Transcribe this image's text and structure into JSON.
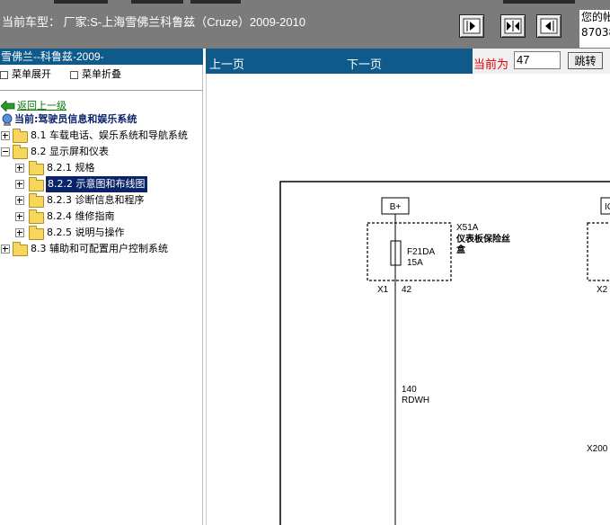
{
  "header": {
    "car_model": "当前车型：  厂家:S-上海雪佛兰科鲁兹（Cruze）2009-2010",
    "user_line1": "您的帐",
    "user_line2": "87038"
  },
  "left": {
    "title": "雪佛兰--科鲁兹-2009-",
    "expand_all": "菜单展开",
    "collapse_all": "菜单折叠",
    "back": "返回上一级",
    "current": "当前:驾驶员信息和娱乐系统",
    "tree": [
      {
        "label": "8.1 车载电话、娱乐系统和导航系统",
        "state": "collapsed",
        "level": 0
      },
      {
        "label": "8.2 显示屏和仪表",
        "state": "expanded",
        "level": 0
      },
      {
        "label": "8.2.1 规格",
        "state": "collapsed",
        "level": 1
      },
      {
        "label": "8.2.2 示意图和布线图",
        "state": "collapsed",
        "level": 1,
        "selected": true
      },
      {
        "label": "8.2.3 诊断信息和程序",
        "state": "collapsed",
        "level": 1
      },
      {
        "label": "8.2.4 维修指南",
        "state": "collapsed",
        "level": 1
      },
      {
        "label": "8.2.5 说明与操作",
        "state": "collapsed",
        "level": 1
      },
      {
        "label": "8.3 辅助和可配置用户控制系统",
        "state": "collapsed",
        "level": 0
      }
    ]
  },
  "pager": {
    "prev": "上一页",
    "next": "下一页",
    "current_label": "当前为",
    "current_value": "47",
    "go": "跳转"
  },
  "diagram": {
    "bplus": "B+",
    "ig_partial": "IG",
    "fusebox_id": "X51A",
    "fusebox_name_line1": "仪表板保险丝",
    "fusebox_name_line2": "盒",
    "fuse_name": "F21DA",
    "fuse_rating": "15A",
    "conn_x1": "X1",
    "pin_42": "42",
    "conn_x2": "X2",
    "wire_gauge": "140",
    "wire_color": "RDWH",
    "conn_x200": "X200"
  }
}
